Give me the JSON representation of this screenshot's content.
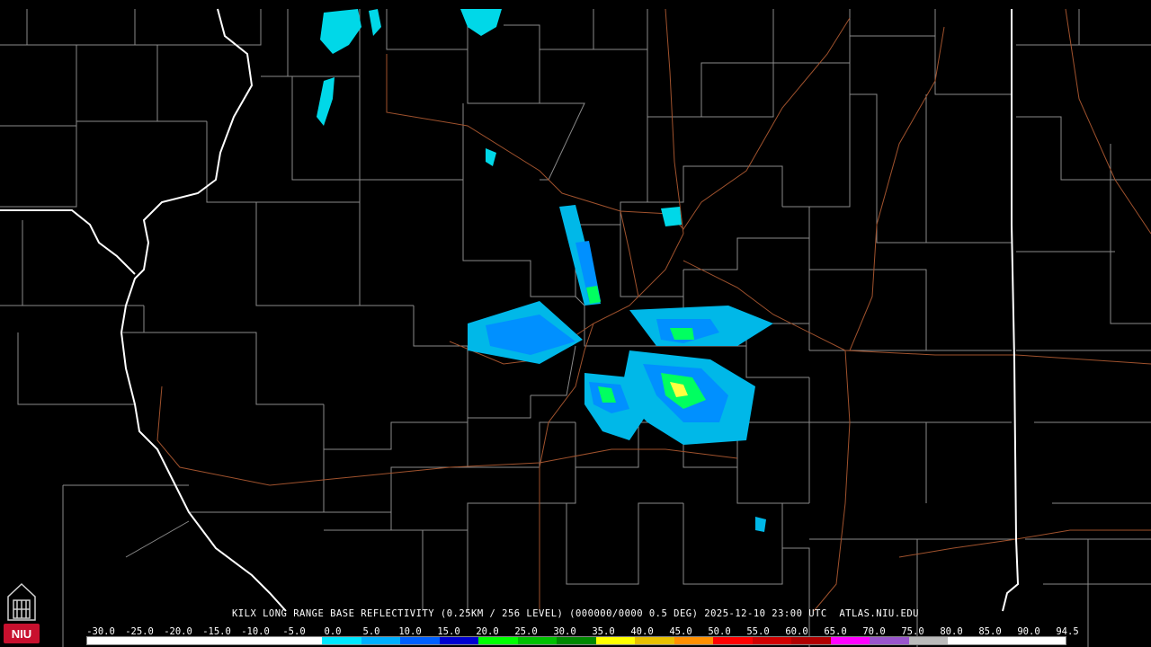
{
  "product_caption": "KILX LONG RANGE BASE REFLECTIVITY (0.25KM / 256 LEVEL) (000000/0000 0.5 DEG) 2025-12-10 23:00 UTC  ATLAS.NIU.EDU",
  "logo_text": "NIU",
  "colorbar": {
    "tick_labels": [
      "-30.0",
      "-25.0",
      "-20.0",
      "-15.0",
      "-10.0",
      "-5.0",
      "0.0",
      "5.0",
      "10.0",
      "15.0",
      "20.0",
      "25.0",
      "30.0",
      "35.0",
      "40.0",
      "45.0",
      "50.0",
      "55.0",
      "60.0",
      "65.0",
      "70.0",
      "75.0",
      "80.0",
      "85.0",
      "90.0",
      "94.5"
    ],
    "colors": [
      "#ffffff",
      "#ffffff",
      "#ffffff",
      "#ffffff",
      "#ffffff",
      "#ffffff",
      "#00e8ff",
      "#00b0ff",
      "#0060ff",
      "#0000d0",
      "#00ff00",
      "#00c000",
      "#008800",
      "#ffff00",
      "#e8c000",
      "#ff9000",
      "#ff0000",
      "#d00000",
      "#b00000",
      "#ff00ff",
      "#9955cc",
      "#bbbbbb",
      "#ffffff",
      "#ffffff",
      "#ffffff"
    ]
  },
  "colors": {
    "county_lines": "#8a8a8a",
    "state_lines": "#ffffff",
    "highways": "#a0522d",
    "echo_light": "#00d8e8",
    "echo_mid": "#0090ff",
    "echo_strong": "#00ff60",
    "echo_max": "#ffff40"
  }
}
